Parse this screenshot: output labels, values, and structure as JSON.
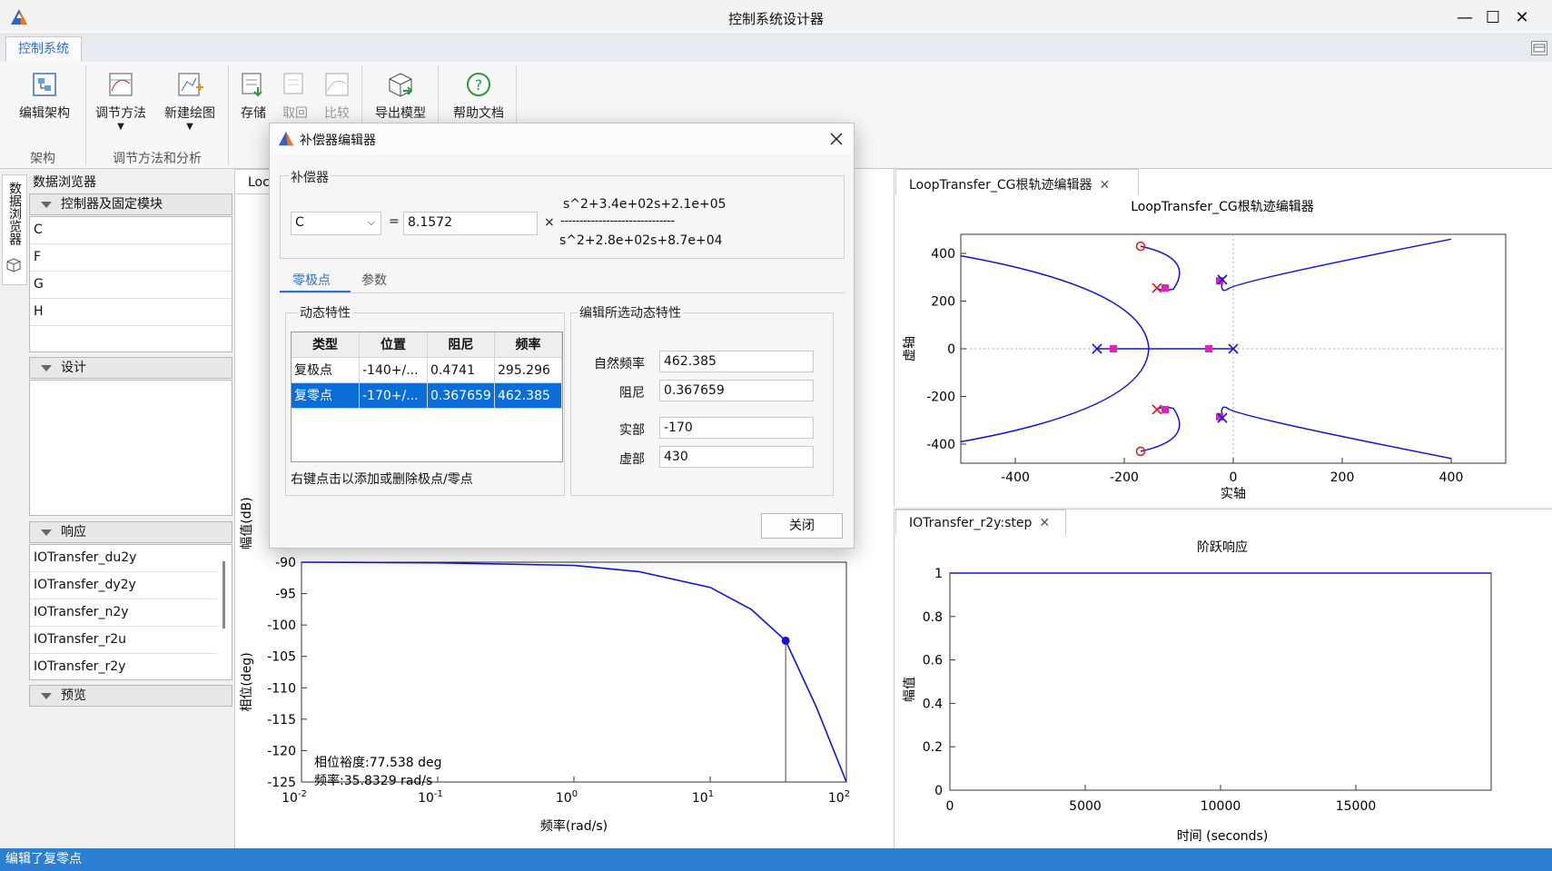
{
  "window": {
    "title": "控制系统设计器",
    "minimize": "—",
    "maximize": "☐",
    "close": "✕"
  },
  "ribbon": {
    "tab": "控制系统",
    "buttons": {
      "edit_arch": "编辑架构",
      "tuning": "调节方法",
      "new_plot": "新建绘图",
      "store": "存储",
      "retrieve": "取回",
      "compare": "比较",
      "export": "导出模型",
      "help": "帮助文档"
    },
    "groups": {
      "arch": "架构",
      "tuning": "调节方法和分析"
    }
  },
  "browser": {
    "vertical_tab": "数据浏览器",
    "title": "数据浏览器",
    "sections": {
      "controllers": "控制器及固定模块",
      "design": "设计",
      "responses": "响应",
      "preview": "预览"
    },
    "controllers": [
      "C",
      "F",
      "G",
      "H"
    ],
    "responses": [
      "IOTransfer_du2y",
      "IOTransfer_dy2y",
      "IOTransfer_n2y",
      "IOTransfer_r2u",
      "IOTransfer_r2y"
    ]
  },
  "center_tab": "Loc",
  "dialog": {
    "title": "补偿器编辑器",
    "compensator_label": "补偿器",
    "select_value": "C",
    "equals": "=",
    "gain": "8.1572",
    "times": "×",
    "numerator": "s^2+3.4e+02s+2.1e+05",
    "fraction_line": "------------------------------",
    "denominator": "s^2+2.8e+02s+8.7e+04",
    "tabs": {
      "poles_zeros": "零极点",
      "params": "参数"
    },
    "dynamics_label": "动态特性",
    "table": {
      "headers": [
        "类型",
        "位置",
        "阻尼",
        "频率"
      ],
      "rows": [
        [
          "复极点",
          "-140+/...",
          "0.4741",
          "295.296"
        ],
        [
          "复零点",
          "-170+/...",
          "0.367659",
          "462.385"
        ]
      ]
    },
    "hint": "右键点击以添加或删除极点/零点",
    "edit_label": "编辑所选动态特性",
    "fields": {
      "natural_freq_label": "自然频率",
      "natural_freq": "462.385",
      "damping_label": "阻尼",
      "damping": "0.367659",
      "real_label": "实部",
      "real": "-170",
      "imag_label": "虚部",
      "imag": "430"
    },
    "close_button": "关闭"
  },
  "bode": {
    "ylabel_mag": "幅值(dB)",
    "ylabel_phase": "相位(deg)",
    "xlabel": "频率(rad/s)",
    "annotation_margin": "相位裕度:77.538 deg",
    "annotation_freq": "频率:35.8329 rad/s",
    "phase_ticks": [
      "-90",
      "-95",
      "-100",
      "-105",
      "-110",
      "-115",
      "-120",
      "-125"
    ],
    "x_ticks": [
      {
        "base": "10",
        "exp": "-2"
      },
      {
        "base": "10",
        "exp": "-1"
      },
      {
        "base": "10",
        "exp": "0"
      },
      {
        "base": "10",
        "exp": "1"
      },
      {
        "base": "10",
        "exp": "2"
      }
    ]
  },
  "root_locus": {
    "tab": "LoopTransfer_CG根轨迹编辑器",
    "title": "LoopTransfer_CG根轨迹编辑器",
    "xlabel": "实轴",
    "ylabel": "虚轴",
    "x_ticks": [
      "-400",
      "-200",
      "0",
      "200",
      "400"
    ],
    "y_ticks": [
      "400",
      "200",
      "0",
      "-200",
      "-400"
    ]
  },
  "step": {
    "tab": "IOTransfer_r2y:step",
    "title": "阶跃响应",
    "xlabel": "时间 (seconds)",
    "ylabel": "幅值",
    "x_ticks": [
      "0",
      "5000",
      "10000",
      "15000"
    ],
    "y_ticks": [
      "1",
      "0.8",
      "0.6",
      "0.4",
      "0.2",
      "0"
    ]
  },
  "chart_data": [
    {
      "type": "line",
      "title": "",
      "xlabel": "频率(rad/s)",
      "ylabel": "相位(deg)",
      "xscale": "log",
      "xlim": [
        0.01,
        100
      ],
      "ylim": [
        -125,
        -90
      ],
      "series": [
        {
          "values_x": [
            0.01,
            0.1,
            1,
            3,
            10,
            20,
            35.8,
            60,
            100
          ],
          "values_y": [
            -90,
            -90.1,
            -90.5,
            -91.5,
            -94,
            -97.5,
            -102.5,
            -113,
            -125
          ]
        }
      ],
      "annotations": [
        "相位裕度:77.538 deg",
        "频率:35.8329 rad/s"
      ]
    },
    {
      "type": "scatter",
      "title": "LoopTransfer_CG根轨迹编辑器",
      "xlabel": "实轴",
      "ylabel": "虚轴",
      "xlim": [
        -500,
        500
      ],
      "ylim": [
        -480,
        480
      ],
      "open_loop_poles": [
        [
          -250,
          0
        ],
        [
          0,
          0
        ],
        [
          -20,
          290
        ],
        [
          -20,
          -290
        ]
      ],
      "open_loop_zeros": [
        [
          -170,
          430
        ],
        [
          -170,
          -430
        ]
      ],
      "compensator_poles": [
        [
          -140,
          255
        ],
        [
          -140,
          -255
        ]
      ],
      "closed_loop_poles": [
        [
          -220,
          0
        ],
        [
          -45,
          0
        ],
        [
          -125,
          255
        ],
        [
          -125,
          -255
        ],
        [
          -25,
          285
        ],
        [
          -25,
          -285
        ]
      ]
    },
    {
      "type": "line",
      "title": "阶跃响应",
      "xlabel": "时间 (seconds)",
      "ylabel": "幅值",
      "xlim": [
        0,
        20000
      ],
      "ylim": [
        0,
        1
      ],
      "series": [
        {
          "x": [
            0,
            19000
          ],
          "y": [
            1,
            1
          ]
        }
      ]
    }
  ]
}
